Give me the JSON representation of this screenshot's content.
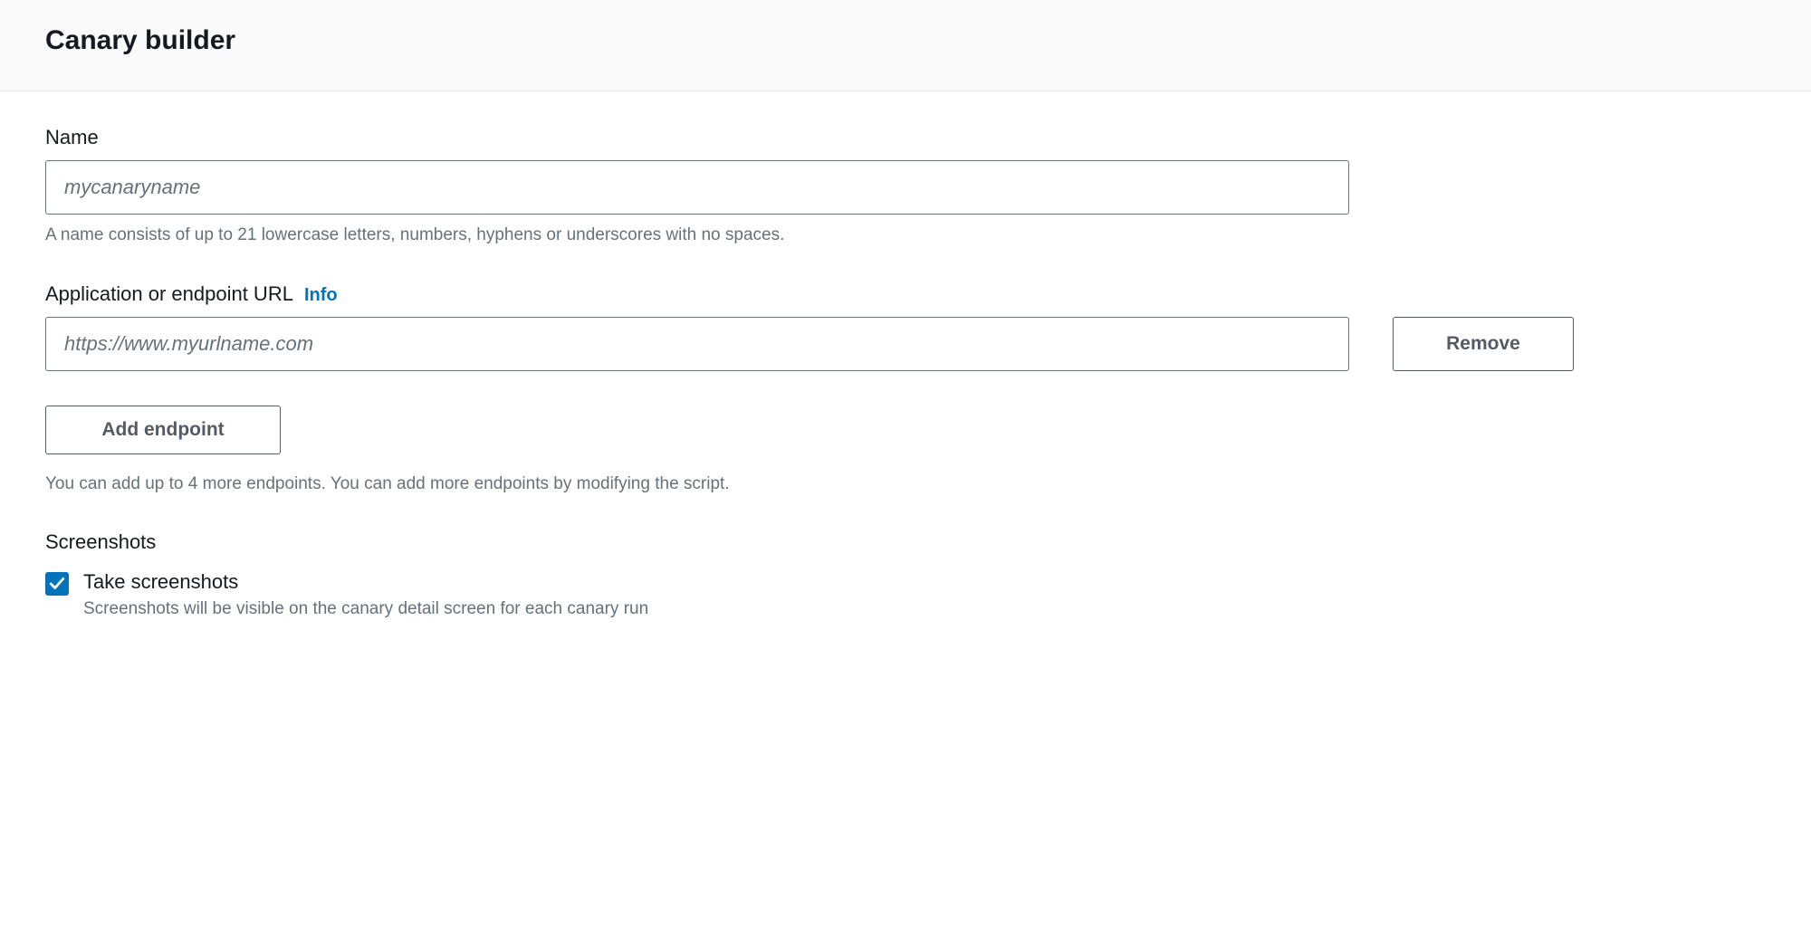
{
  "header": {
    "title": "Canary builder"
  },
  "name_field": {
    "label": "Name",
    "placeholder": "mycanaryname",
    "value": "",
    "helper": "A name consists of up to 21 lowercase letters, numbers, hyphens or underscores with no spaces."
  },
  "url_field": {
    "label": "Application or endpoint URL",
    "info_label": "Info",
    "placeholder": "https://www.myurlname.com",
    "value": "",
    "remove_label": "Remove"
  },
  "add_endpoint": {
    "button_label": "Add endpoint",
    "helper": "You can add up to 4 more endpoints. You can add more endpoints by modifying the script."
  },
  "screenshots": {
    "heading": "Screenshots",
    "checkbox_label": "Take screenshots",
    "helper": "Screenshots will be visible on the canary detail screen for each canary run",
    "checked": true
  }
}
